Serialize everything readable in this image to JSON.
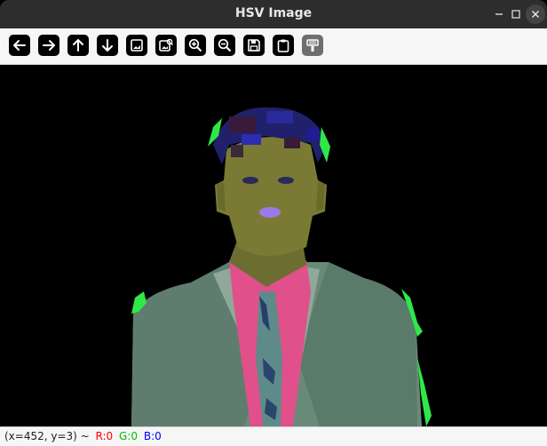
{
  "window": {
    "title": "HSV Image"
  },
  "toolbar": {
    "buttons": [
      {
        "name": "pan-left",
        "icon": "arrow-left-icon"
      },
      {
        "name": "pan-right",
        "icon": "arrow-right-icon"
      },
      {
        "name": "pan-up",
        "icon": "arrow-up-icon"
      },
      {
        "name": "pan-down",
        "icon": "arrow-down-icon"
      },
      {
        "name": "zoom-fit",
        "icon": "image-icon"
      },
      {
        "name": "zoom-original",
        "icon": "image-zoom-icon"
      },
      {
        "name": "zoom-in",
        "icon": "zoom-in-icon"
      },
      {
        "name": "zoom-out",
        "icon": "zoom-out-icon"
      },
      {
        "name": "save",
        "icon": "save-icon"
      },
      {
        "name": "copy",
        "icon": "clipboard-icon"
      },
      {
        "name": "properties",
        "icon": "properties-icon"
      }
    ]
  },
  "status": {
    "coords": "(x=452, y=3) ~",
    "r": "R:0",
    "g": "G:0",
    "b": "B:0",
    "colors": {
      "r": "#ff0000",
      "g": "#00c000",
      "b": "#0000ff"
    }
  }
}
